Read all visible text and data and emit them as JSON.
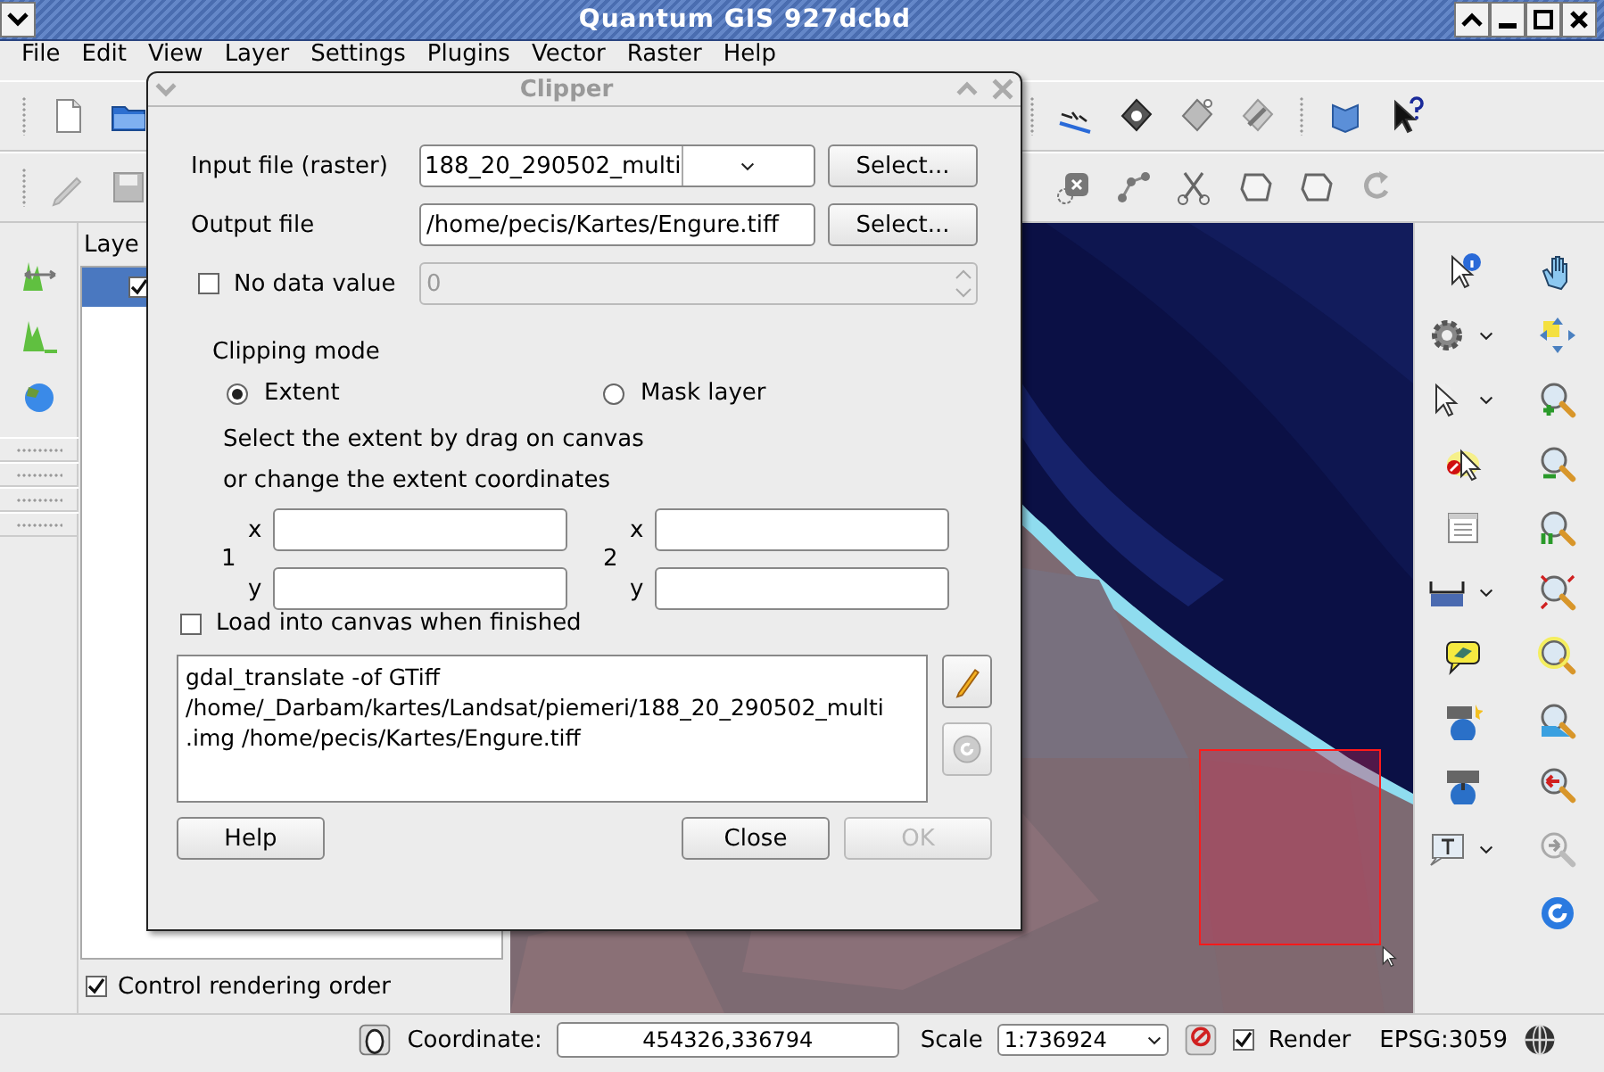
{
  "window": {
    "title": "Quantum GIS 927dcbd"
  },
  "menu": [
    "File",
    "Edit",
    "View",
    "Layer",
    "Settings",
    "Plugins",
    "Vector",
    "Raster",
    "Help"
  ],
  "layers_panel": {
    "title": "Laye",
    "layers": [
      {
        "checked": true,
        "selected": true
      }
    ],
    "control_rendering_order": {
      "label": "Control rendering order",
      "checked": true
    }
  },
  "status_bar": {
    "coordinate_label": "Coordinate:",
    "coordinate": "454326,336794",
    "scale_label": "Scale",
    "scale": "1:736924",
    "render": {
      "label": "Render",
      "checked": true
    },
    "crs": "EPSG:3059"
  },
  "dialog": {
    "title": "Clipper",
    "input": {
      "label": "Input file (raster)",
      "value": "188_20_290502_multi",
      "button": "Select..."
    },
    "output": {
      "label": "Output file",
      "value": "/home/pecis/Kartes/Engure.tiff",
      "button": "Select..."
    },
    "no_data": {
      "label": "No data value",
      "checked": false,
      "value": "0",
      "disabled": true
    },
    "clipping_mode": {
      "label": "Clipping mode",
      "options": [
        {
          "label": "Extent",
          "selected": true
        },
        {
          "label": "Mask layer",
          "selected": false
        }
      ]
    },
    "hint": [
      "Select the extent by drag on canvas",
      "or change the extent coordinates"
    ],
    "corners": [
      {
        "label": "1",
        "x_label": "x",
        "y_label": "y"
      },
      {
        "label": "2",
        "x_label": "x",
        "y_label": "y"
      }
    ],
    "load_into_canvas": {
      "label": "Load into canvas when finished",
      "checked": false
    },
    "command": "gdal_translate -of GTiff\n/home/_Darbam/kartes/Landsat/piemeri/188_20_290502_multi\n.img /home/pecis/Kartes/Engure.tiff",
    "buttons": [
      {
        "label": "Help",
        "disabled": false
      },
      {
        "label": "Close",
        "disabled": false
      },
      {
        "label": "OK",
        "disabled": true
      }
    ]
  }
}
